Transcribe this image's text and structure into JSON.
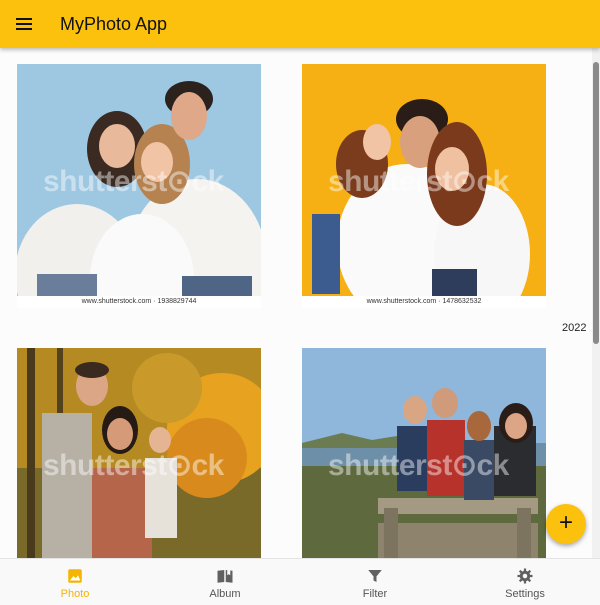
{
  "app_bar": {
    "title": "MyPhoto App",
    "color": "#fcc10c"
  },
  "photos": [
    {
      "caption": "www.shutterstock.com · 1938829744",
      "watermark": "shutterst⊙ck"
    },
    {
      "caption": "www.shutterstock.com · 1478632532",
      "watermark": "shutterst⊙ck"
    },
    {
      "caption": "",
      "watermark": "shutterst⊙ck"
    },
    {
      "caption": "",
      "watermark": "shutterst⊙ck"
    }
  ],
  "group_label": "2022",
  "fab": {
    "icon": "plus-icon",
    "symbol": "+"
  },
  "bottom_nav": {
    "items": [
      {
        "label": "Photo",
        "icon": "photo-icon",
        "active": true
      },
      {
        "label": "Album",
        "icon": "album-icon",
        "active": false
      },
      {
        "label": "Filter",
        "icon": "filter-icon",
        "active": false
      },
      {
        "label": "Settings",
        "icon": "gear-icon",
        "active": false
      }
    ],
    "active_color": "#f5b400"
  }
}
